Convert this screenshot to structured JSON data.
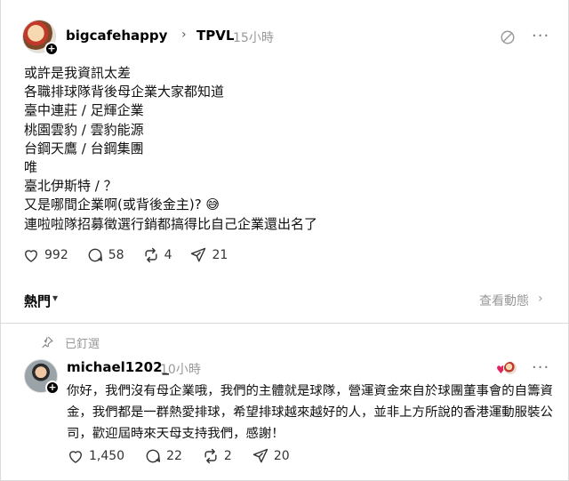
{
  "post": {
    "username": "bigcafehappy",
    "community": "TPVL",
    "time": "15小時",
    "lines": [
      "或許是我資訊太差",
      "各職排球隊背後母企業大家都知道",
      "臺中連莊 / 足輝企業",
      "桃園雲豹 / 雲豹能源",
      "台鋼天鷹 / 台鋼集團",
      "唯",
      "臺北伊斯特 / ？",
      "又是哪間企業啊(或背後金主)? 😅",
      "連啦啦隊招募徵選行銷都搞得比自己企業還出名了"
    ],
    "likes": "992",
    "replies": "58",
    "reposts": "4",
    "shares": "21"
  },
  "section": {
    "sort_label": "熱門",
    "view_activity": "查看動態"
  },
  "pinned_label": "已釘選",
  "reply": {
    "username": "michael1202_",
    "time": "10小時",
    "text": "你好，我們沒有母企業哦，我們的主體就是球隊，營運資金來自於球團董事會的自籌資金，我們都是一群熱愛排球，希望排球越來越好的人，並非上方所說的香港運動服裝公司，歡迎屆時來天母支持我們，感謝！",
    "likes": "1,450",
    "replies": "22",
    "reposts": "2",
    "shares": "20"
  },
  "icons": {
    "more": "more-icon",
    "mute": "mute-icon",
    "heart": "heart-icon",
    "comment": "comment-icon",
    "repost": "repost-icon",
    "share": "share-icon",
    "pin": "pin-icon"
  }
}
